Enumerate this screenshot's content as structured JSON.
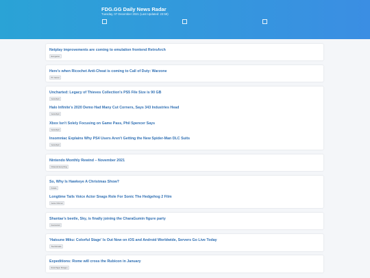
{
  "header": {
    "title": "FDG.GG Daily News Radar",
    "subtitle": "Tuesday, 07 December 2021 (Last Updated: 23:59)"
  },
  "groups": [
    {
      "items": [
        {
          "headline": "Netplay improvements are coming to emulation frontend RetroArch",
          "source": "Eurogamer"
        }
      ]
    },
    {
      "items": [
        {
          "headline": "Here's when Ricochet Anti-Cheat is coming to Call of Duty: Warzone",
          "source": "PC Gamer"
        }
      ]
    },
    {
      "items": [
        {
          "headline": "Uncharted: Legacy of Thieves Collection's PS5 File Size is 90 GB",
          "source": "GameSpot"
        },
        {
          "headline": "Halo Infinite's 2020 Demo Had Many Cut Corners, Says 343 Industries Head",
          "source": "GameSpot"
        },
        {
          "headline": "Xbox Isn't Solely Focusing on Game Pass, Phil Spencer Says",
          "source": "GameSpot"
        },
        {
          "headline": "Insomniac Explains Why PS4 Users Aren't Getting the New Spider-Man DLC Suits",
          "source": "GameSpot"
        }
      ]
    },
    {
      "items": [
        {
          "headline": "Nintendo Monthly Rewind – November 2021",
          "source": "Nintendo Everything"
        }
      ]
    },
    {
      "items": [
        {
          "headline": "So, Why Is Hawkeye A Christmas Show?",
          "source": "Kotaku"
        },
        {
          "headline": "Longtime Tails Voice Actor Snags Role For Sonic The Hedgehog 2 Film",
          "source": "Game Informer"
        }
      ]
    },
    {
      "items": [
        {
          "headline": "Shantae's beetle, Sky, is finally joining the CharaGumin figure party",
          "source": "Destructoid"
        }
      ]
    },
    {
      "items": [
        {
          "headline": "'Hatsune Miku: Colorful Stage' Is Out Now on iOS and Android Worldwide, Servers Go Live Today",
          "source": "TouchArcade"
        }
      ]
    },
    {
      "items": [
        {
          "headline": "Expeditions: Rome will cross the Rubicon in January",
          "source": "Rock Paper Shotgun"
        }
      ]
    }
  ]
}
